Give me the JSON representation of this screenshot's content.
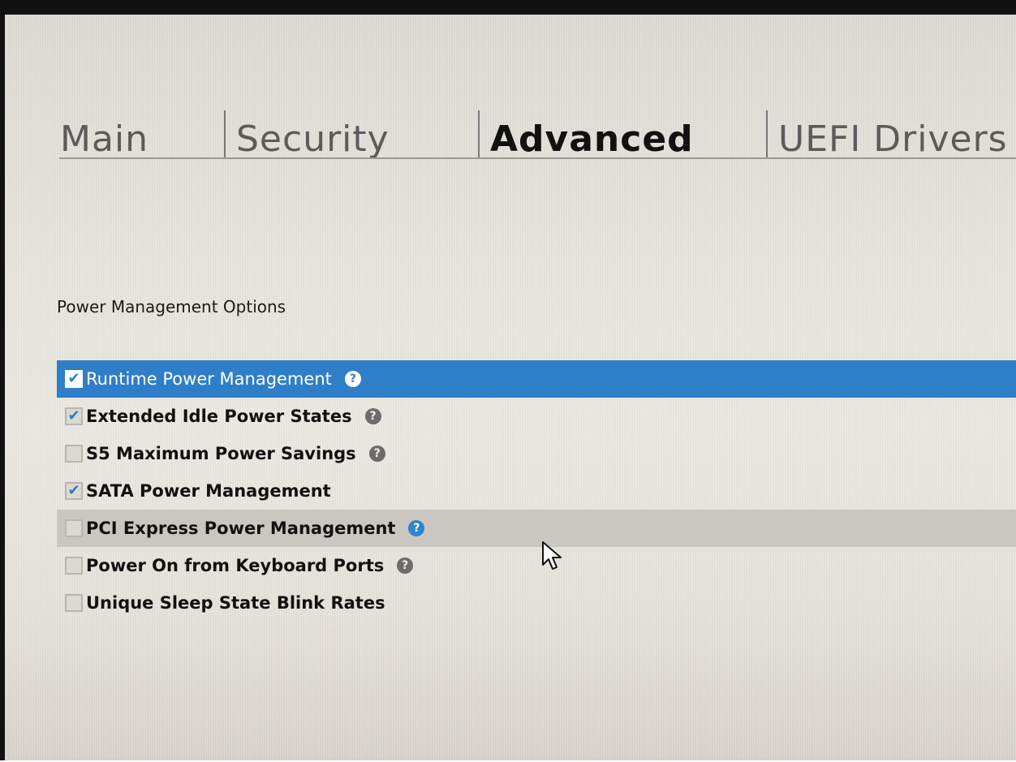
{
  "tabs": [
    {
      "label": "Main",
      "active": false
    },
    {
      "label": "Security",
      "active": false
    },
    {
      "label": "Advanced",
      "active": true
    },
    {
      "label": "UEFI Drivers",
      "active": false
    }
  ],
  "section": {
    "title": "Power Management Options"
  },
  "options": [
    {
      "label": "Runtime Power Management",
      "checked": true,
      "help": true,
      "state": "selected"
    },
    {
      "label": "Extended Idle Power States",
      "checked": true,
      "help": true,
      "state": "normal"
    },
    {
      "label": "S5 Maximum Power Savings",
      "checked": false,
      "help": true,
      "state": "normal"
    },
    {
      "label": "SATA Power Management",
      "checked": true,
      "help": false,
      "state": "normal"
    },
    {
      "label": "PCI Express Power Management",
      "checked": false,
      "help": true,
      "state": "hover"
    },
    {
      "label": "Power On from Keyboard Ports",
      "checked": false,
      "help": true,
      "state": "normal"
    },
    {
      "label": "Unique Sleep State Blink Rates",
      "checked": false,
      "help": false,
      "state": "normal"
    }
  ],
  "icons": {
    "help": "question-mark-icon",
    "check": "checkmark-icon",
    "cursor": "mouse-pointer-icon"
  },
  "colors": {
    "selection": "#2f7ec8",
    "hover": "#cac7c2",
    "help_blue": "#2e84cf",
    "help_gray": "#6d6c6a"
  }
}
